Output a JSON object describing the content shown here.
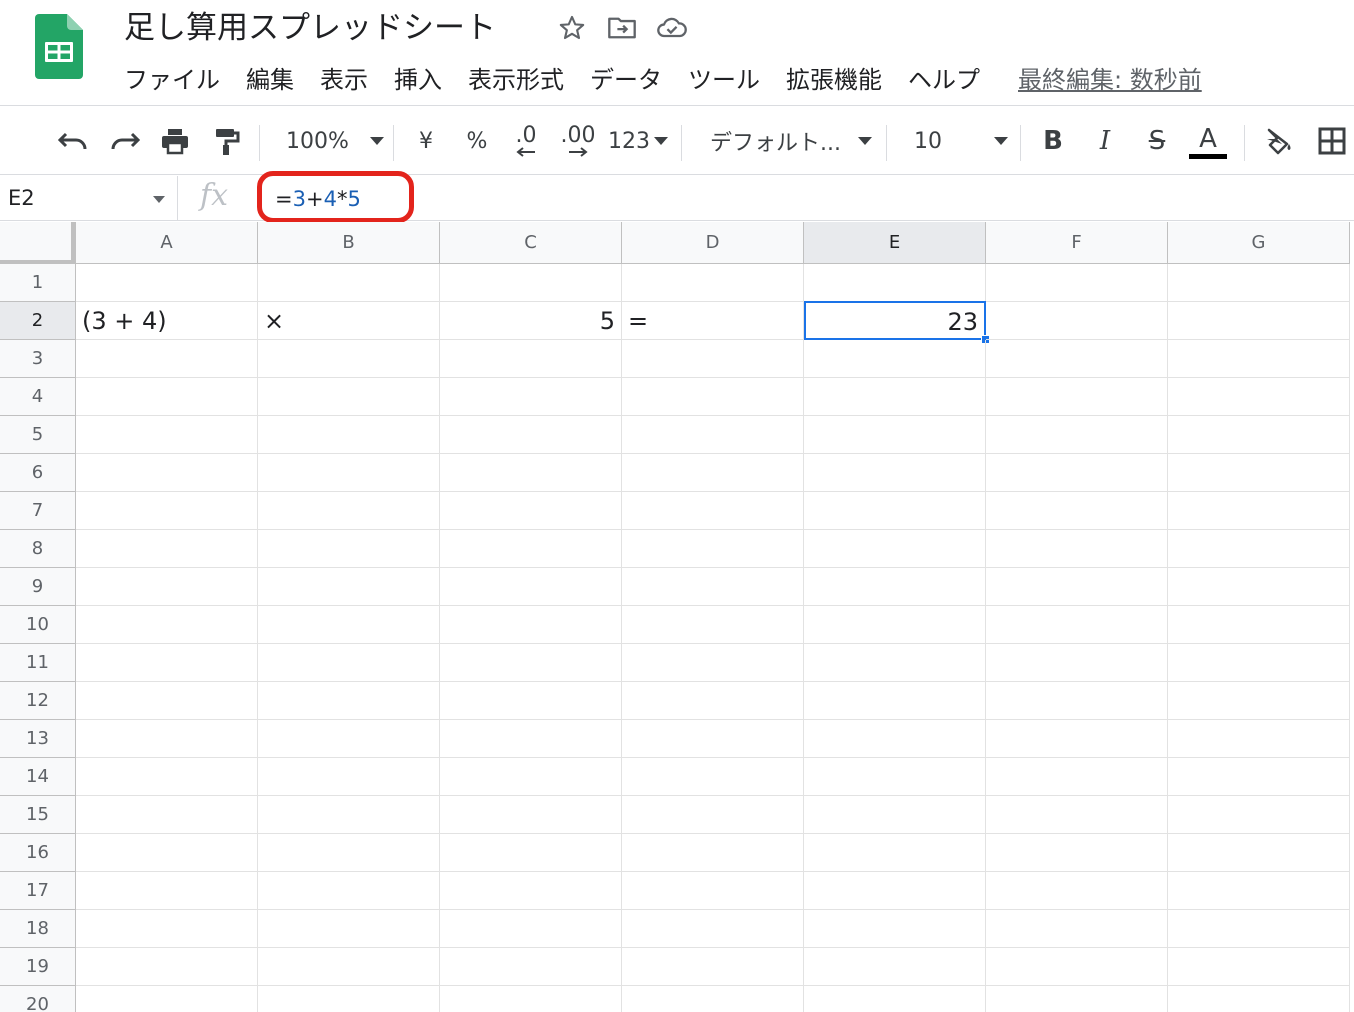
{
  "document": {
    "title": "足し算用スプレッドシート"
  },
  "menu": [
    "ファイル",
    "編集",
    "表示",
    "挿入",
    "表示形式",
    "データ",
    "ツール",
    "拡張機能",
    "ヘルプ"
  ],
  "last_edit": "最終編集: 数秒前",
  "toolbar": {
    "zoom": "100%",
    "currency": "¥",
    "percent": "%",
    "decrease_decimal": ".0",
    "increase_decimal": ".00",
    "more_formats": "123",
    "font_family": "デフォルト...",
    "font_size": "10",
    "bold": "B",
    "italic": "I",
    "strikethrough": "S",
    "text_color": "A"
  },
  "formula_bar": {
    "name_box": "E2",
    "fx": "fx",
    "formula_parts": [
      "=",
      "3",
      "+",
      "4",
      "*",
      "5"
    ]
  },
  "grid": {
    "columns": [
      "A",
      "B",
      "C",
      "D",
      "E",
      "F",
      "G"
    ],
    "rows": [
      "1",
      "2",
      "3",
      "4",
      "5",
      "6",
      "7",
      "8",
      "9",
      "10",
      "11",
      "12",
      "13",
      "14",
      "15",
      "16",
      "17",
      "18",
      "19",
      "20"
    ],
    "selected_cell": "E2",
    "cells": {
      "A2": "(3 + 4)",
      "B2": "×",
      "C2": "5",
      "D2": "=",
      "E2": "23"
    }
  },
  "colors": {
    "sheets_green": "#23a566",
    "selection_blue": "#1a73e8",
    "annotation_red": "#e3241c",
    "formula_number_blue": "#1a5fb4"
  }
}
